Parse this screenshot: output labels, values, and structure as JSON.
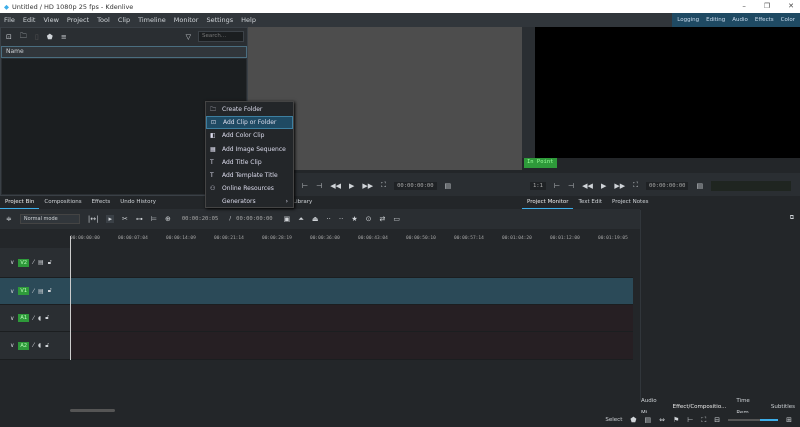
{
  "window": {
    "title": "Untitled / HD 1080p 25 fps - Kdenlive"
  },
  "menu": [
    "File",
    "Edit",
    "View",
    "Project",
    "Tool",
    "Clip",
    "Timeline",
    "Monitor",
    "Settings",
    "Help"
  ],
  "workspaces": [
    "Logging",
    "Editing",
    "Audio",
    "Effects",
    "Color"
  ],
  "bin": {
    "search_placeholder": "Search...",
    "column": "Name"
  },
  "clip_monitor": {
    "timecode": "00:00:00:00"
  },
  "project_monitor": {
    "timecode": "00:00:00:00",
    "in_point": "In Point",
    "zoom": "1:1"
  },
  "context_menu": [
    {
      "label": "Create Folder",
      "icon": "folder-icon"
    },
    {
      "label": "Add Clip or Folder",
      "icon": "add-clip-icon",
      "highlighted": true
    },
    {
      "label": "Add Color Clip",
      "icon": "color-clip-icon"
    },
    {
      "label": "Add Image Sequence",
      "icon": "image-sequence-icon"
    },
    {
      "label": "Add Title Clip",
      "icon": "title-icon"
    },
    {
      "label": "Add Template Title",
      "icon": "title-icon"
    },
    {
      "label": "Online Resources",
      "icon": "online-icon"
    },
    {
      "label": "Generators",
      "icon": "submenu-arrow-icon"
    }
  ],
  "left_tabs": [
    "Project Bin",
    "Compositions",
    "Effects",
    "Undo History"
  ],
  "library_tab": "Library",
  "monitor_tabs": [
    "Project Monitor",
    "Text Edit",
    "Project Notes"
  ],
  "timeline": {
    "mode": "Normal mode",
    "position": "00:00:20:05",
    "duration": "00:00:00:00",
    "ruler": [
      "00:00:00:00",
      "00:00:07:04",
      "00:00:14:09",
      "00:00:21:14",
      "00:00:28:19",
      "00:00:36:00",
      "00:00:43:04",
      "00:00:50:10",
      "00:00:57:14",
      "00:01:04:20",
      "00:01:12:00",
      "00:01:19:05"
    ],
    "tracks": [
      {
        "name": "V2",
        "type": "video"
      },
      {
        "name": "V1",
        "type": "video",
        "selected": true
      },
      {
        "name": "A1",
        "type": "audio"
      },
      {
        "name": "A2",
        "type": "audio"
      }
    ]
  },
  "bottom_tabs": [
    "Audio Mi...",
    "Effect/Compositio...",
    "Time Rem...",
    "Subtitles"
  ],
  "status": {
    "select": "Select"
  },
  "colors": {
    "accent": "#3daee9",
    "track_label": "#2e9a3a",
    "selected_track": "#2b4a58"
  }
}
